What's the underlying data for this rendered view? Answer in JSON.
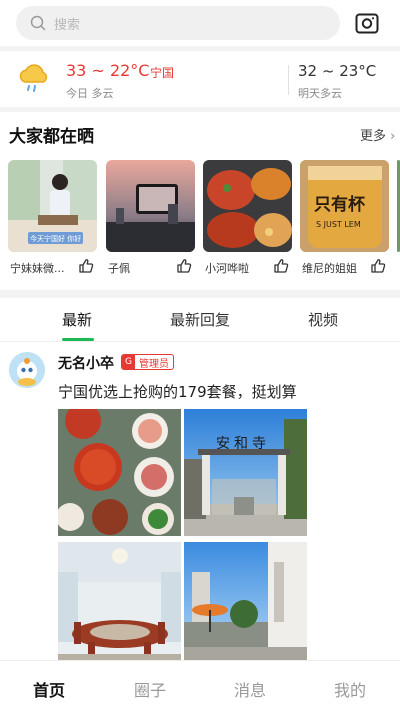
{
  "search": {
    "placeholder": "搜索",
    "icon": "search-icon"
  },
  "camera_icon": "camera-icon",
  "weather": {
    "today_temp": "33 ~ 22°C",
    "city": "宁国",
    "today_label": "今日 多云",
    "tomorrow_temp": "32 ~ 23°C",
    "tomorrow_label": "明天多云",
    "icon": "cloud-rain-icon",
    "accent": "#e53935"
  },
  "share": {
    "title": "大家都在晒",
    "more": "更多",
    "cards": [
      {
        "name": "宁妹妹微...",
        "thumb": "thumbs-up-icon",
        "overlay": "今天宁国好 你好"
      },
      {
        "name": "子佩",
        "thumb": "thumbs-up-icon"
      },
      {
        "name": "小河哗啦",
        "thumb": "thumbs-up-icon"
      },
      {
        "name": "维尼的姐姐",
        "thumb": "thumbs-up-icon",
        "overlay": "只有杯",
        "overlay2": "S JUST LEM"
      }
    ]
  },
  "tabs": [
    {
      "label": "最新",
      "active": true
    },
    {
      "label": "最新回复",
      "active": false
    },
    {
      "label": "视频",
      "active": false
    }
  ],
  "post": {
    "user": "无名小卒",
    "badge_icon": "G",
    "badge_text": "管理员",
    "text": "宁国优选上抢购的179套餐，挺划算",
    "gate_text": "安和寺"
  },
  "nav": [
    {
      "label": "首页",
      "active": true
    },
    {
      "label": "圈子",
      "active": false
    },
    {
      "label": "消息",
      "active": false
    },
    {
      "label": "我的",
      "active": false
    }
  ],
  "colors": {
    "accent_green": "#1db954",
    "red": "#e53935"
  }
}
